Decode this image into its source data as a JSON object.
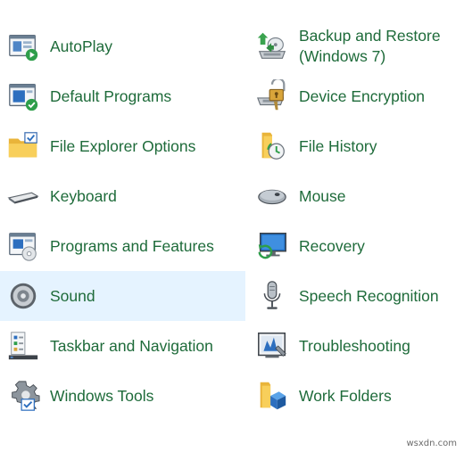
{
  "items": [
    {
      "label": "AutoPlay",
      "icon": "autoplay-icon"
    },
    {
      "label": "Backup and Restore (Windows 7)",
      "icon": "backup-restore-icon"
    },
    {
      "label": "Default Programs",
      "icon": "default-programs-icon"
    },
    {
      "label": "Device Encryption",
      "icon": "device-encryption-icon"
    },
    {
      "label": "File Explorer Options",
      "icon": "file-explorer-options-icon"
    },
    {
      "label": "File History",
      "icon": "file-history-icon"
    },
    {
      "label": "Keyboard",
      "icon": "keyboard-icon"
    },
    {
      "label": "Mouse",
      "icon": "mouse-icon"
    },
    {
      "label": "Programs and Features",
      "icon": "programs-features-icon"
    },
    {
      "label": "Recovery",
      "icon": "recovery-icon"
    },
    {
      "label": "Sound",
      "icon": "speaker-icon",
      "selected": true
    },
    {
      "label": "Speech Recognition",
      "icon": "microphone-icon"
    },
    {
      "label": "Taskbar and Navigation",
      "icon": "taskbar-icon"
    },
    {
      "label": "Troubleshooting",
      "icon": "troubleshooting-icon"
    },
    {
      "label": "Windows Tools",
      "icon": "windows-tools-icon"
    },
    {
      "label": "Work Folders",
      "icon": "work-folders-icon"
    }
  ],
  "colors": {
    "link_text": "#1e6b3a",
    "selected_background": "#e5f3ff"
  },
  "watermark": "wsxdn.com"
}
